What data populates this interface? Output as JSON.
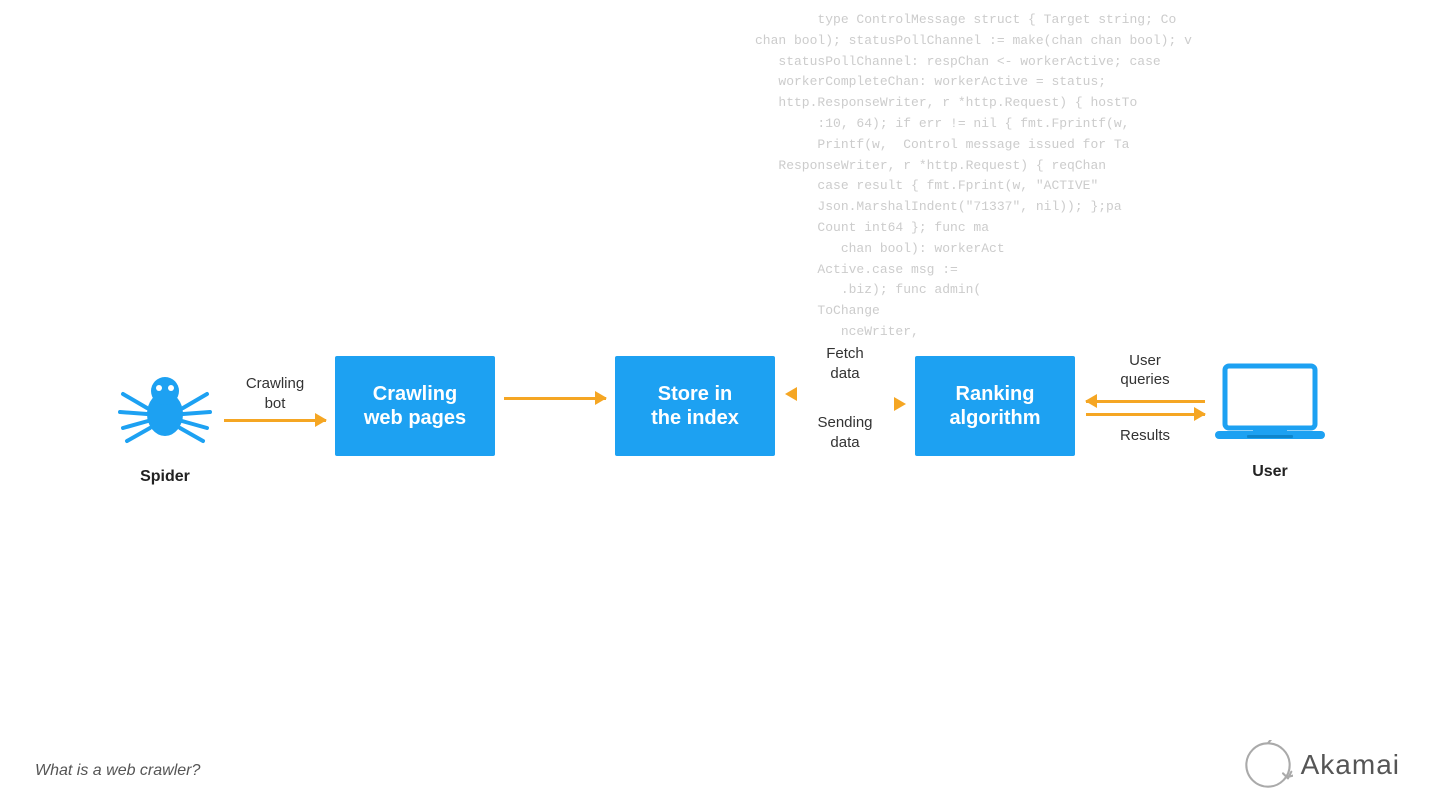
{
  "code_bg": {
    "lines": [
      "type ControlMessage struct { Target string; Co",
      "chan bool); statusPollChannel := make(chan chan bool); v",
      "   statusPollChannel: respChan <- workerActive; case",
      "   workerCompleteChan: workerActive = status;",
      "   http.ResponseWriter, r *http.Request) { hostTo",
      "   :10, 64); if err != nil { fmt.Fprintf(w,",
      "   Printf(w,  Control message issued for Ta",
      "   ResponseWriter, r *http.Request) { reqChan",
      "   case result { fmt.Fprint(w, \"ACTIVE\"",
      "   Json.MarshalIndent(\"71337\", nil)); };pa",
      "   Count int64 }; func ma",
      "   chan bool): workerAct",
      "   Active.case msg :=",
      "   .biz); func admin(",
      "   ToChange",
      "   nceWriter,",
      ""
    ]
  },
  "diagram": {
    "steps": [
      {
        "type": "icon",
        "id": "spider",
        "label_below": "Spider"
      },
      {
        "type": "arrow_single_right",
        "label": "Crawling\nbot"
      },
      {
        "type": "box",
        "id": "crawling",
        "text": "Crawling\nweb pages"
      },
      {
        "type": "arrow_single_right",
        "label": ""
      },
      {
        "type": "box",
        "id": "store",
        "text": "Store in\nthe index"
      },
      {
        "type": "arrow_double",
        "label_top": "Fetch\ndata",
        "label_bottom": "Sending\ndata"
      },
      {
        "type": "box",
        "id": "ranking",
        "text": "Ranking\nalgorithm"
      },
      {
        "type": "arrow_double",
        "label_top": "User\nqueries",
        "label_bottom": "Results"
      },
      {
        "type": "icon",
        "id": "user",
        "label_below": "User"
      }
    ]
  },
  "bottom_text": "What is a web crawler?",
  "akamai_label": "Akamai",
  "colors": {
    "blue": "#1da1f2",
    "orange": "#f5a623",
    "text_dark": "#222222",
    "text_mid": "#555555",
    "code_color": "#cccccc"
  }
}
